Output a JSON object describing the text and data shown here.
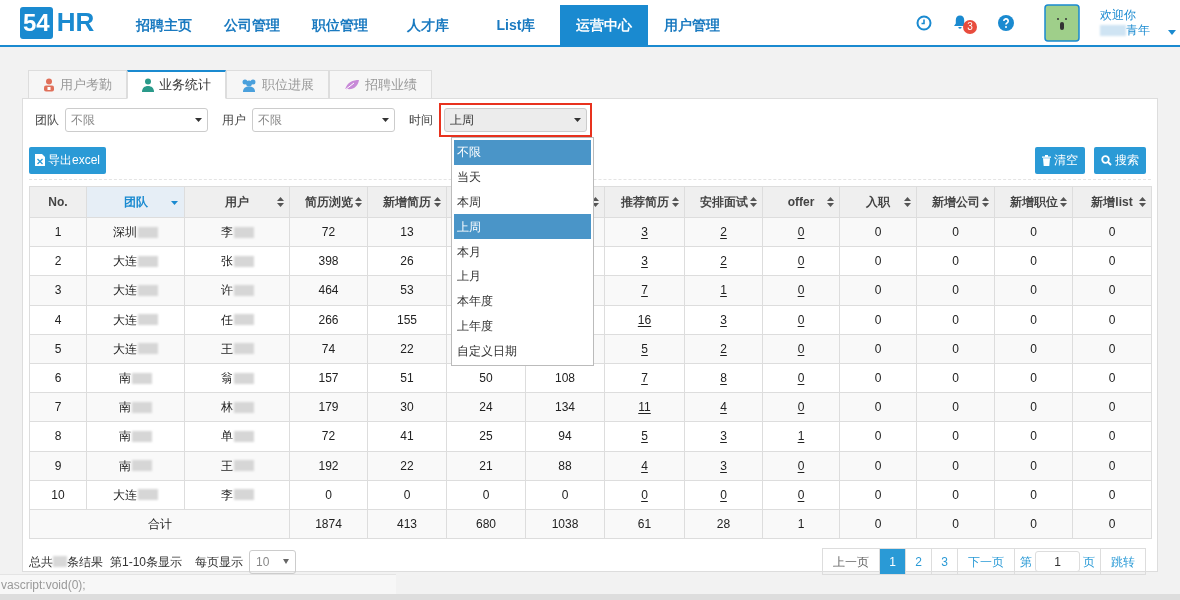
{
  "logo": {
    "badge": "54",
    "text": "HR"
  },
  "nav": [
    {
      "label": "招聘主页",
      "selected": false
    },
    {
      "label": "公司管理",
      "selected": false
    },
    {
      "label": "职位管理",
      "selected": false
    },
    {
      "label": "人才库",
      "selected": false
    },
    {
      "label": "List库",
      "selected": false
    },
    {
      "label": "运营中心",
      "selected": true
    },
    {
      "label": "用户管理",
      "selected": false
    }
  ],
  "notifications": {
    "count": "3"
  },
  "user": {
    "greeting": "欢迎你",
    "name": "青年"
  },
  "tabs": [
    {
      "label": "用户考勤",
      "selected": false,
      "kind": "attendance",
      "color": "#e0705a"
    },
    {
      "label": "业务统计",
      "selected": true,
      "kind": "person",
      "color": "#2a9a8a"
    },
    {
      "label": "职位进展",
      "selected": false,
      "kind": "group",
      "color": "#4aa0dc"
    },
    {
      "label": "招聘业绩",
      "selected": false,
      "kind": "leaf",
      "color": "#c88ad8"
    }
  ],
  "filters": [
    {
      "label": "团队",
      "value": "不限",
      "highlighted": false
    },
    {
      "label": "用户",
      "value": "不限",
      "highlighted": false
    },
    {
      "label": "时间",
      "value": "上周",
      "highlighted": true
    }
  ],
  "time_options": [
    {
      "label": "不限",
      "highlighted": true
    },
    {
      "label": "当天",
      "highlighted": false
    },
    {
      "label": "本周",
      "highlighted": false
    },
    {
      "label": "上周",
      "highlighted": true
    },
    {
      "label": "本月",
      "highlighted": false
    },
    {
      "label": "上月",
      "highlighted": false
    },
    {
      "label": "本年度",
      "highlighted": false
    },
    {
      "label": "上年度",
      "highlighted": false
    },
    {
      "label": "自定义日期",
      "highlighted": false
    }
  ],
  "buttons": {
    "export": "导出excel",
    "clear": "清空",
    "search": "搜索"
  },
  "table": {
    "columns": [
      {
        "label": "No.",
        "sortable": false,
        "sorted": false,
        "link": false
      },
      {
        "label": "团队",
        "sortable": true,
        "sorted": true,
        "link": false
      },
      {
        "label": "用户",
        "sortable": true,
        "sorted": false,
        "link": false
      },
      {
        "label": "简历浏览",
        "sortable": true,
        "sorted": false,
        "link": false
      },
      {
        "label": "新增简历",
        "sortable": true,
        "sorted": false,
        "link": false
      },
      {
        "link": false
      },
      {
        "sortable": true,
        "sorted": false,
        "link": false
      },
      {
        "label": "推荐简历",
        "sortable": true,
        "sorted": false,
        "link": true
      },
      {
        "label": "安排面试",
        "sortable": true,
        "sorted": false,
        "link": true
      },
      {
        "label": "offer",
        "sortable": true,
        "sorted": false,
        "link": true
      },
      {
        "label": "入职",
        "sortable": true,
        "sorted": false,
        "link": false
      },
      {
        "label": "新增公司",
        "sortable": true,
        "sorted": false,
        "link": false
      },
      {
        "label": "新增职位",
        "sortable": true,
        "sorted": false,
        "link": false
      },
      {
        "label": "新增list",
        "sortable": true,
        "sorted": false,
        "link": false
      }
    ],
    "rows": [
      {
        "cells": [
          "1",
          "深圳",
          "李",
          "72",
          "13",
          null,
          null,
          "3",
          "2",
          "0",
          "0",
          "0",
          "0",
          "0"
        ]
      },
      {
        "cells": [
          "2",
          "大连",
          "张",
          "398",
          "26",
          null,
          null,
          "3",
          "2",
          "0",
          "0",
          "0",
          "0",
          "0"
        ]
      },
      {
        "cells": [
          "3",
          "大连",
          "许",
          "464",
          "53",
          null,
          null,
          "7",
          "1",
          "0",
          "0",
          "0",
          "0",
          "0"
        ]
      },
      {
        "cells": [
          "4",
          "大连",
          "任",
          "266",
          "155",
          null,
          null,
          "16",
          "3",
          "0",
          "0",
          "0",
          "0",
          "0"
        ]
      },
      {
        "cells": [
          "5",
          "大连",
          "王",
          "74",
          "22",
          null,
          null,
          "5",
          "2",
          "0",
          "0",
          "0",
          "0",
          "0"
        ]
      },
      {
        "cells": [
          "6",
          "南",
          "翁",
          "157",
          "51",
          "50",
          "108",
          "7",
          "8",
          "0",
          "0",
          "0",
          "0",
          "0"
        ]
      },
      {
        "cells": [
          "7",
          "南",
          "林",
          "179",
          "30",
          "24",
          "134",
          "11",
          "4",
          "0",
          "0",
          "0",
          "0",
          "0"
        ]
      },
      {
        "cells": [
          "8",
          "南",
          "单",
          "72",
          "41",
          "25",
          "94",
          "5",
          "3",
          "1",
          "0",
          "0",
          "0",
          "0"
        ]
      },
      {
        "cells": [
          "9",
          "南",
          "王",
          "192",
          "22",
          "21",
          "88",
          "4",
          "3",
          "0",
          "0",
          "0",
          "0",
          "0"
        ]
      },
      {
        "cells": [
          "10",
          "大连",
          "李",
          "0",
          "0",
          "0",
          "0",
          "0",
          "0",
          "0",
          "0",
          "0",
          "0",
          "0"
        ]
      }
    ],
    "total": {
      "label": "合计",
      "cells": [
        "1874",
        "413",
        "680",
        "1038",
        "61",
        "28",
        "1",
        "0",
        "0",
        "0",
        "0"
      ]
    }
  },
  "footer": {
    "total_prefix": "总共",
    "total_suffix": "条结果",
    "range": "第1-10条显示",
    "per_page_label": "每页显示",
    "per_page": "10"
  },
  "pagination": {
    "prev": "上一页",
    "pages": [
      {
        "label": "1",
        "selected": true
      },
      {
        "label": "2",
        "selected": false
      },
      {
        "label": "3",
        "selected": false
      }
    ],
    "next": "下一页",
    "goto_prefix": "第",
    "goto_value": "1",
    "goto_suffix": "页",
    "goto": "跳转"
  },
  "status_bar": "vascript:void(0);"
}
